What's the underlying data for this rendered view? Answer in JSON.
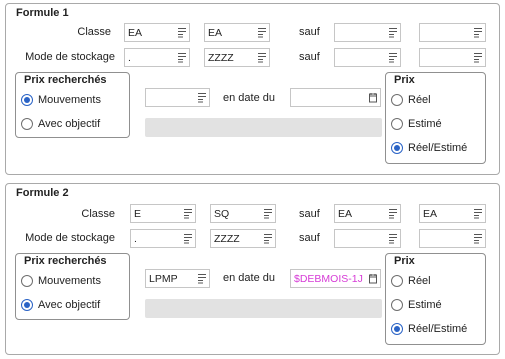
{
  "f1": {
    "title": "Formule 1",
    "classe_label": "Classe",
    "stockage_label": "Mode de stockage",
    "sauf_label": "sauf",
    "classe_vals": [
      "EA",
      "EA",
      "",
      ""
    ],
    "stockage_vals": [
      ".",
      "ZZZZ",
      "",
      ""
    ],
    "prix_title": "Prix recherchés",
    "prix_opts": [
      "Mouvements",
      "Avec objectif"
    ],
    "prix_selected": 0,
    "ref_value": "",
    "en_date_label": "en date du",
    "date_value": "",
    "prix2_title": "Prix",
    "prix2_opts": [
      "Réel",
      "Estimé",
      "Réel/Estimé"
    ],
    "prix2_selected": 2
  },
  "f2": {
    "title": "Formule 2",
    "classe_label": "Classe",
    "stockage_label": "Mode de stockage",
    "sauf_label": "sauf",
    "classe_vals": [
      "E",
      "SQ",
      "EA",
      "EA"
    ],
    "stockage_vals": [
      ".",
      "ZZZZ",
      "",
      ""
    ],
    "prix_title": "Prix recherchés",
    "prix_opts": [
      "Mouvements",
      "Avec objectif"
    ],
    "prix_selected": 1,
    "ref_value": "LPMP",
    "en_date_label": "en date du",
    "date_value": "$DEBMOIS-1J",
    "prix2_title": "Prix",
    "prix2_opts": [
      "Réel",
      "Estimé",
      "Réel/Estimé"
    ],
    "prix2_selected": 2
  },
  "colors": {
    "accent": "#2a63c6",
    "variable_text": "#d63bd6",
    "disabled": "#e2e2e2"
  },
  "icons": {
    "field_picker": "list-icon",
    "date_picker": "calendar-icon"
  }
}
